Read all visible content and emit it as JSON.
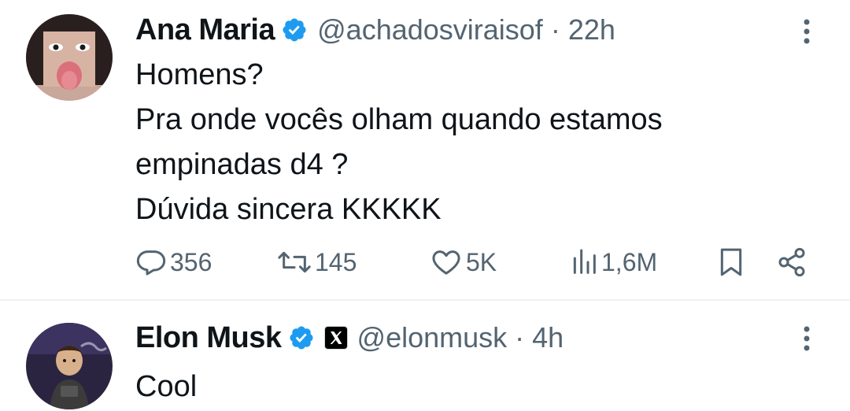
{
  "tweets": [
    {
      "name": "Ana Maria",
      "handle": "@achadosviraisof",
      "separator": "·",
      "time": "22h",
      "lines": [
        "Homens?",
        "Pra onde vocês olham quando estamos",
        "empinadas d4 ?",
        "Dúvida sincera KKKKK"
      ],
      "stats": {
        "replies": "356",
        "retweets": "145",
        "likes": "5K",
        "views": "1,6M"
      }
    },
    {
      "name": "Elon Musk",
      "handle": "@elonmusk",
      "separator": "·",
      "time": "4h",
      "lines": [
        "Cool"
      ]
    }
  ],
  "icons": {
    "verified": "verified-badge-icon",
    "x_affiliate": "x-logo-icon",
    "more": "more-vertical-icon",
    "reply": "reply-icon",
    "retweet": "retweet-icon",
    "like": "heart-icon",
    "views": "views-icon",
    "bookmark": "bookmark-icon",
    "share": "share-icon"
  },
  "colors": {
    "verified": "#1d9bf0",
    "text_primary": "#0f1419",
    "text_secondary": "#536471",
    "divider": "#eff3f4"
  }
}
